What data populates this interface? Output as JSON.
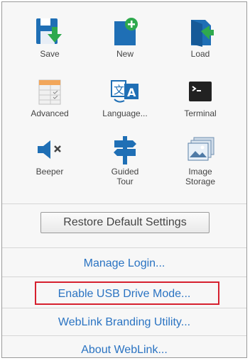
{
  "tools": [
    {
      "label": "Save",
      "icon": "save-icon"
    },
    {
      "label": "New",
      "icon": "new-document-icon"
    },
    {
      "label": "Load",
      "icon": "load-icon"
    },
    {
      "label": "Advanced",
      "icon": "advanced-icon"
    },
    {
      "label": "Language...",
      "icon": "language-icon"
    },
    {
      "label": "Terminal",
      "icon": "terminal-icon"
    },
    {
      "label": "Beeper",
      "icon": "beeper-mute-icon"
    },
    {
      "label": "Guided\nTour",
      "icon": "guided-tour-signpost-icon"
    },
    {
      "label": "Image\nStorage",
      "icon": "image-storage-icon"
    }
  ],
  "restore_button": "Restore Default Settings",
  "links": [
    {
      "label": "Manage Login..."
    },
    {
      "label": "Enable USB Drive Mode..."
    },
    {
      "label": "WebLink Branding Utility..."
    },
    {
      "label": "About WebLink..."
    }
  ],
  "colors": {
    "accent_blue": "#1f6fb5",
    "accent_green": "#2fa94e",
    "link": "#2a73c2",
    "highlight_border": "#d6202e"
  }
}
